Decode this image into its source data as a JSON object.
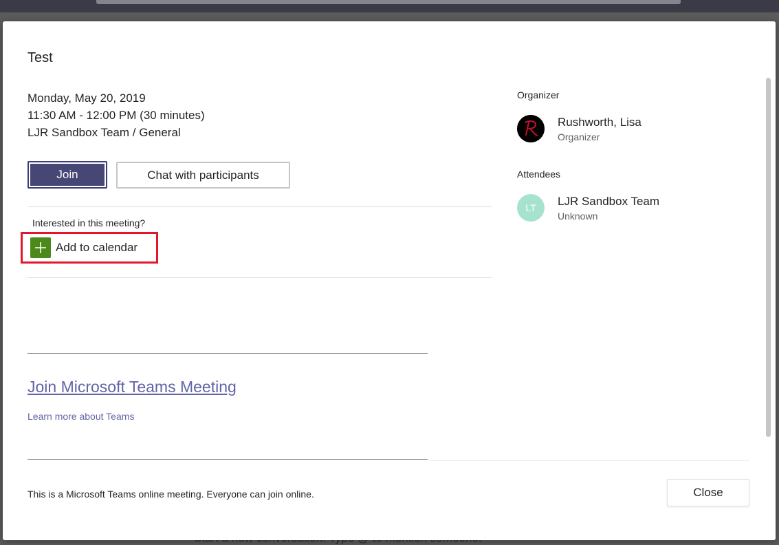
{
  "background": {
    "compose_hint": "Start a new conversation. Type @ to mention someone."
  },
  "meeting": {
    "title": "Test",
    "date": "Monday, May 20, 2019",
    "time": "11:30 AM - 12:00 PM (30 minutes)",
    "channel": "LJR Sandbox Team / General"
  },
  "actions": {
    "join_label": "Join",
    "chat_label": "Chat with participants"
  },
  "interest": {
    "prompt": "Interested in this meeting?",
    "add_calendar_label": "Add to calendar"
  },
  "body": {
    "join_link": "Join Microsoft Teams Meeting",
    "learn_link": "Learn more about Teams"
  },
  "sidebar": {
    "organizer_heading": "Organizer",
    "organizer": {
      "name": "Rushworth, Lisa",
      "role": "Organizer"
    },
    "attendees_heading": "Attendees",
    "attendees": [
      {
        "initials": "LT",
        "name": "LJR Sandbox Team",
        "role": "Unknown"
      }
    ]
  },
  "footer": {
    "note": "This is a Microsoft Teams online meeting. Everyone can join online.",
    "close_label": "Close"
  },
  "colors": {
    "brand": "#464775",
    "link": "#6264a7",
    "highlight": "#e3162d",
    "add_green": "#4b8a1a",
    "attendee_avatar": "#a6e3cf"
  }
}
